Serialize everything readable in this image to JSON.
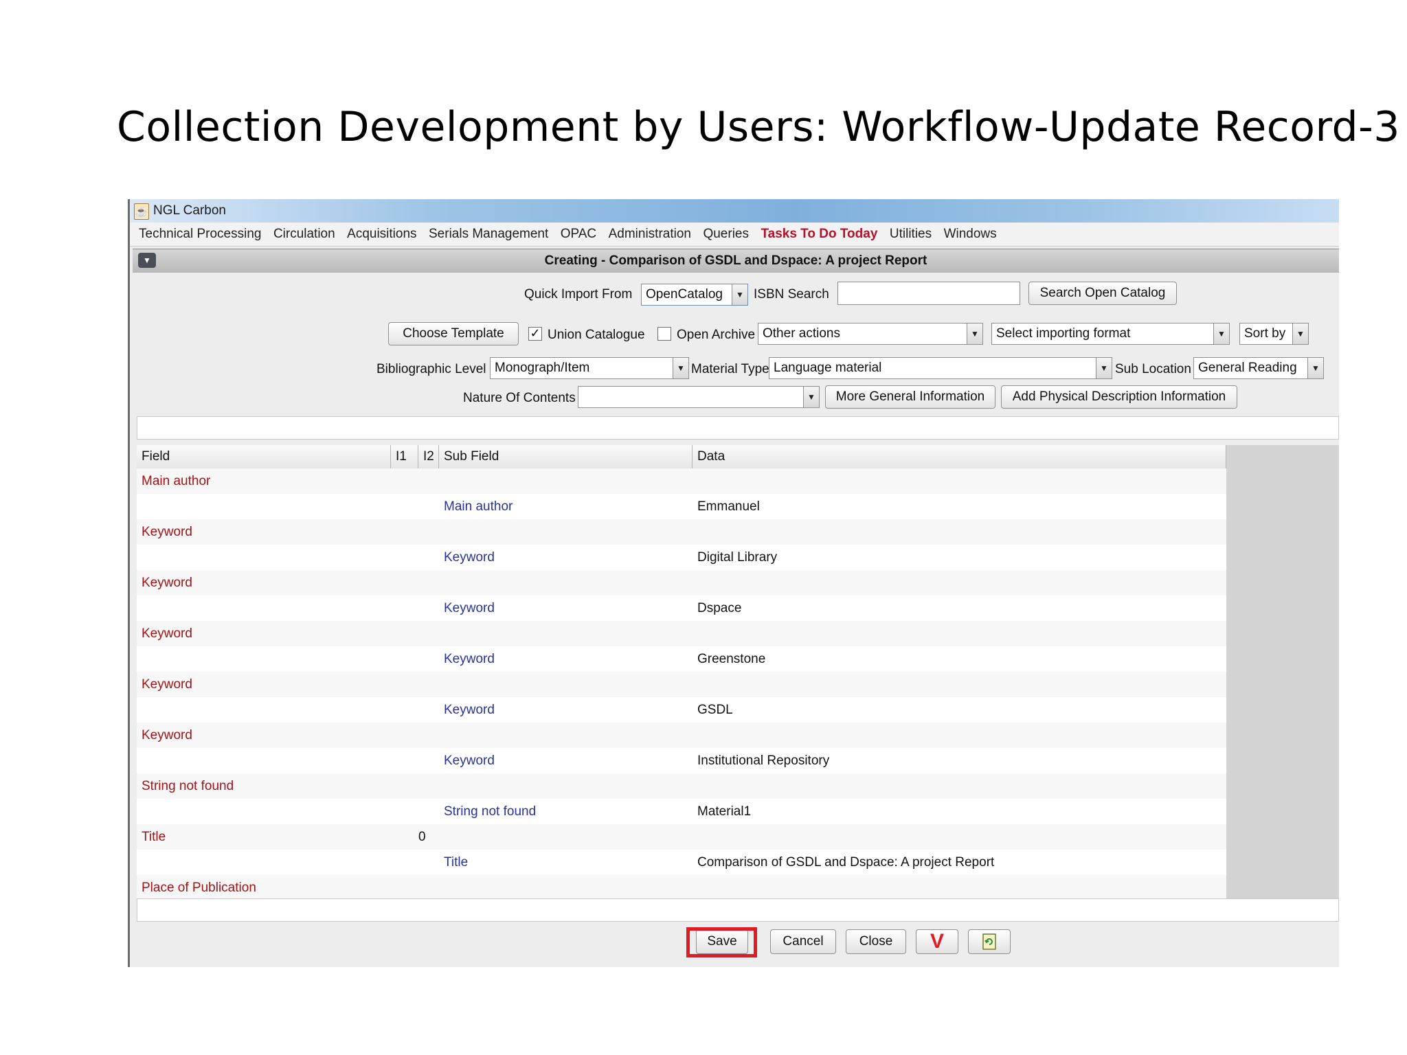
{
  "slide": {
    "title": "Collection Development by Users: Workflow-Update Record-3"
  },
  "window": {
    "app_name": "NGL Carbon"
  },
  "menu": [
    "Technical Processing",
    "Circulation",
    "Acquisitions",
    "Serials Management",
    "OPAC",
    "Administration",
    "Queries",
    "Tasks To Do Today",
    "Utilities",
    "Windows"
  ],
  "frame": {
    "title": "Creating - Comparison of GSDL and Dspace: A project Report"
  },
  "toolbar": {
    "quick_import_label": "Quick Import From",
    "quick_import_value": "OpenCatalog",
    "isbn_label": "ISBN Search",
    "isbn_value": "",
    "search_open_catalog": "Search Open Catalog",
    "choose_template": "Choose Template",
    "union_catalogue_label": "Union Catalogue",
    "union_catalogue_checked": true,
    "open_archive_label": "Open Archive",
    "open_archive_checked": false,
    "other_actions": "Other actions",
    "importing_format": "Select importing format",
    "sort_by": "Sort by",
    "bib_level_label": "Bibliographic Level",
    "bib_level_value": "Monograph/Item",
    "material_type_label": "Material Type",
    "material_type_value": "Language material",
    "sub_location_label": "Sub Location",
    "sub_location_value": "General Reading",
    "nature_label": "Nature Of Contents",
    "nature_value": "",
    "more_general": "More General Information",
    "add_physical": "Add Physical Description Information"
  },
  "table": {
    "headers": {
      "field": "Field",
      "i1": "I1",
      "i2": "I2",
      "sub": "Sub Field",
      "data": "Data"
    },
    "rows": [
      {
        "field": "Main author",
        "i1": "",
        "sub": "",
        "data": ""
      },
      {
        "field": "",
        "i1": "",
        "sub": "Main author",
        "data": "Emmanuel"
      },
      {
        "field": "Keyword",
        "i1": "",
        "sub": "",
        "data": ""
      },
      {
        "field": "",
        "i1": "",
        "sub": "Keyword",
        "data": "Digital Library"
      },
      {
        "field": "Keyword",
        "i1": "",
        "sub": "",
        "data": ""
      },
      {
        "field": "",
        "i1": "",
        "sub": "Keyword",
        "data": "Dspace"
      },
      {
        "field": "Keyword",
        "i1": "",
        "sub": "",
        "data": ""
      },
      {
        "field": "",
        "i1": "",
        "sub": "Keyword",
        "data": "Greenstone"
      },
      {
        "field": "Keyword",
        "i1": "",
        "sub": "",
        "data": ""
      },
      {
        "field": "",
        "i1": "",
        "sub": "Keyword",
        "data": "GSDL"
      },
      {
        "field": "Keyword",
        "i1": "",
        "sub": "",
        "data": ""
      },
      {
        "field": "",
        "i1": "",
        "sub": "Keyword",
        "data": "Institutional Repository"
      },
      {
        "field": "String not found",
        "i1": "",
        "sub": "",
        "data": ""
      },
      {
        "field": "",
        "i1": "",
        "sub": "String not found",
        "data": "Material1"
      },
      {
        "field": "Title",
        "i1": "0",
        "sub": "",
        "data": ""
      },
      {
        "field": "",
        "i1": "",
        "sub": "Title",
        "data": "Comparison of GSDL and Dspace: A project Report"
      },
      {
        "field": "Place of Publication",
        "i1": "",
        "sub": "",
        "data": ""
      }
    ]
  },
  "actions": {
    "save": "Save",
    "cancel": "Cancel",
    "close": "Close",
    "validate_icon": "check-v-icon",
    "refresh_icon": "refresh-icon"
  },
  "colors": {
    "highlight": "#e01b24",
    "field_text": "#a01418",
    "subfield_text": "#27339a",
    "menu_highlight": "#b3122b"
  }
}
